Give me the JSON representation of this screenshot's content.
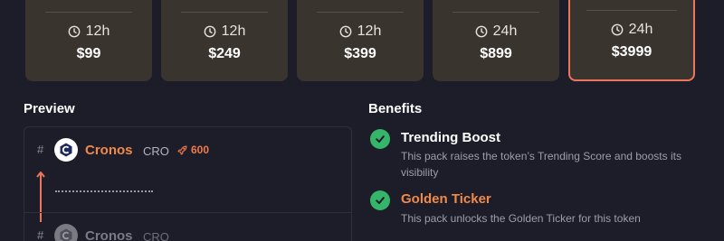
{
  "packs": [
    {
      "duration": "12h",
      "price": "$99",
      "selected": false
    },
    {
      "duration": "12h",
      "price": "$249",
      "selected": false
    },
    {
      "duration": "12h",
      "price": "$399",
      "selected": false
    },
    {
      "duration": "24h",
      "price": "$899",
      "selected": false
    },
    {
      "duration": "24h",
      "price": "$3999",
      "selected": true
    }
  ],
  "preview": {
    "title": "Preview",
    "rows": [
      {
        "rank": "#",
        "name": "Cronos",
        "symbol": "CRO",
        "boost": "600"
      },
      {
        "rank": "#",
        "name": "Cronos",
        "symbol": "CRO"
      }
    ]
  },
  "benefits": {
    "title": "Benefits",
    "items": [
      {
        "title": "Trending Boost",
        "desc": "This pack raises the token’s Trending Score and boosts its visibility"
      },
      {
        "title": "Golden Ticker",
        "desc": "This pack unlocks the Golden Ticker for this token"
      }
    ]
  },
  "colors": {
    "accent": "#ec7659",
    "card_bg": "#39342e",
    "check": "#35b56a",
    "coin_name": "#f08a4b"
  }
}
